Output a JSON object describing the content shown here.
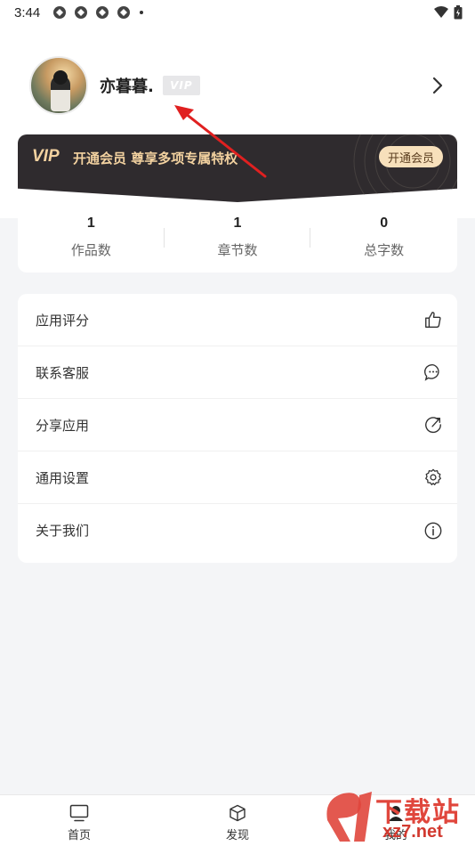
{
  "status_bar": {
    "time": "3:44"
  },
  "profile": {
    "name": "亦暮暮.",
    "vip_badge": "VIP"
  },
  "vip_banner": {
    "logo": "VIP",
    "text": "开通会员 尊享多项专属特权",
    "button_label": "开通会员"
  },
  "stats": [
    {
      "value": "1",
      "label": "作品数"
    },
    {
      "value": "1",
      "label": "章节数"
    },
    {
      "value": "0",
      "label": "总字数"
    }
  ],
  "menu": [
    {
      "label": "应用评分",
      "icon": "thumbs-up-icon"
    },
    {
      "label": "联系客服",
      "icon": "chat-bubble-icon"
    },
    {
      "label": "分享应用",
      "icon": "share-icon"
    },
    {
      "label": "通用设置",
      "icon": "gear-icon"
    },
    {
      "label": "关于我们",
      "icon": "info-icon"
    }
  ],
  "bottom_nav": [
    {
      "label": "首页",
      "icon": "monitor-icon"
    },
    {
      "label": "发现",
      "icon": "cube-icon"
    },
    {
      "label": "我的",
      "icon": "user-icon"
    }
  ],
  "watermark": {
    "brand": "下载站",
    "url": "xz7.net"
  },
  "colors": {
    "vip_gold": "#f3d2a0",
    "banner_dark": "#2f2b2e",
    "annotation_red": "#e02020",
    "watermark_red": "#e0463c"
  }
}
